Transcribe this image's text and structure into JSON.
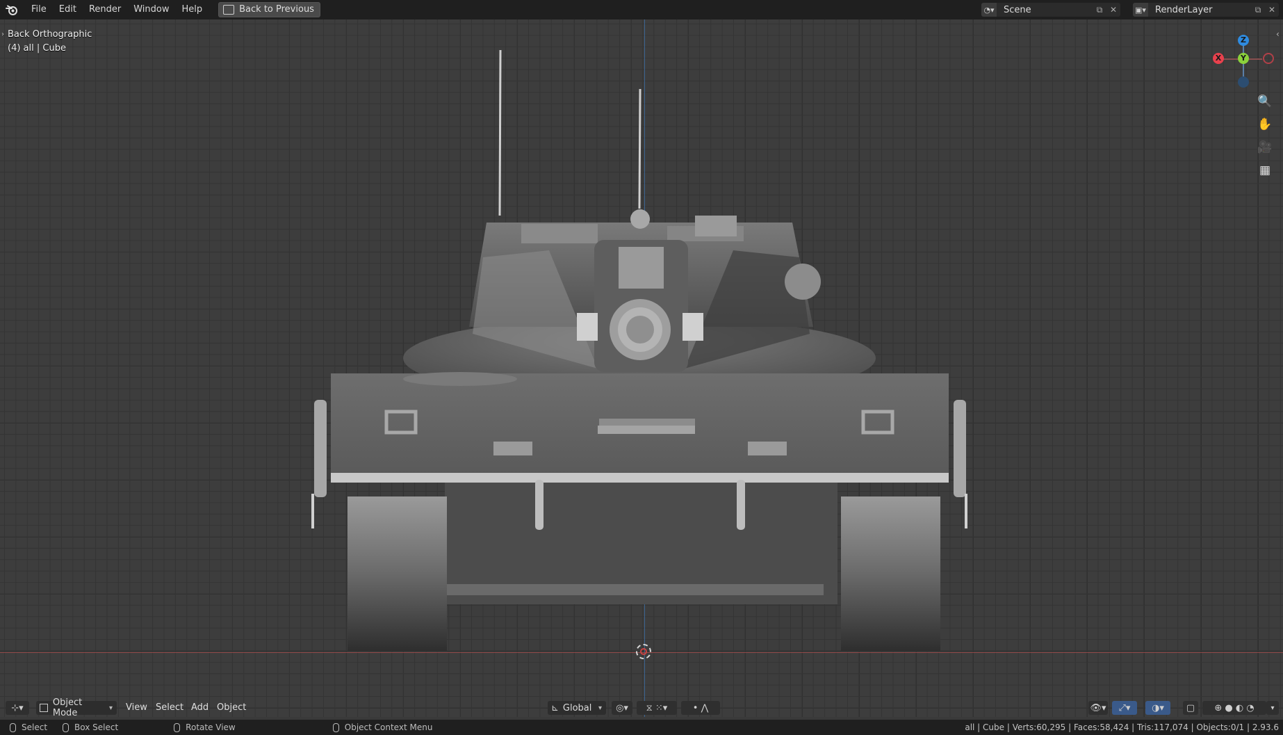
{
  "menu": [
    "File",
    "Edit",
    "Render",
    "Window",
    "Help"
  ],
  "back_button": "Back to Previous",
  "scene": {
    "name": "Scene",
    "icon": "scene-icon"
  },
  "render_layer": {
    "name": "RenderLayer",
    "icon": "renderlayer-icon"
  },
  "viewport": {
    "view_name": "Back Orthographic",
    "collection_info": "(4) all | Cube",
    "gizmo": {
      "x": "X",
      "y": "Y",
      "z": "Z",
      "x_color": "#e8414d",
      "y_color": "#8bd13b",
      "z_color": "#2e8be0"
    }
  },
  "header": {
    "mode": "Object Mode",
    "menus": [
      "View",
      "Select",
      "Add",
      "Object"
    ],
    "orientation": "Global"
  },
  "status": {
    "select": "Select",
    "box_select": "Box Select",
    "rotate": "Rotate View",
    "context_menu": "Object Context Menu",
    "stats": "all | Cube | Verts:60,295 | Faces:58,424 | Tris:117,074 | Objects:0/1 | 2.93.6"
  },
  "colors": {
    "topbar": "#1f1f1f",
    "viewport": "#3d3d3d",
    "accent": "#4772b3"
  }
}
